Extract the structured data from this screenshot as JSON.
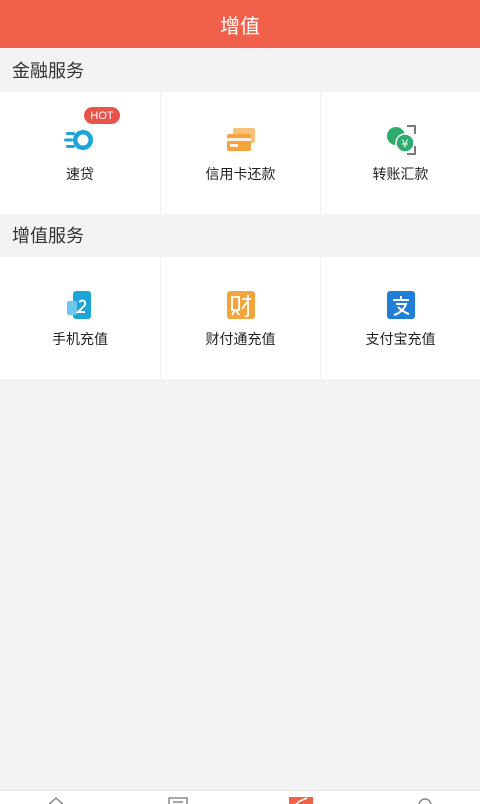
{
  "header": {
    "title": "增值"
  },
  "sections": {
    "finance": {
      "title": "金融服务",
      "items": [
        {
          "label": "速贷",
          "badge": "HOT",
          "icon": "fast-loan-icon",
          "color": "#1aa4d8"
        },
        {
          "label": "信用卡还款",
          "icon": "credit-card-icon",
          "color": "#f3a43c"
        },
        {
          "label": "转账汇款",
          "icon": "transfer-icon",
          "color": "#2dad6c"
        }
      ]
    },
    "value": {
      "title": "增值服务",
      "items": [
        {
          "label": "手机充值",
          "icon": "phone-recharge-icon",
          "color": "#1aa4d8"
        },
        {
          "label": "财付通充值",
          "icon": "tenpay-icon",
          "color": "#f3a43c"
        },
        {
          "label": "支付宝充值",
          "icon": "alipay-icon",
          "color": "#1f7fd6"
        }
      ]
    }
  },
  "bottom_nav": [
    "home-icon",
    "list-icon",
    "value-added-icon",
    "profile-icon"
  ],
  "colors": {
    "accent": "#f0604b",
    "background": "#f3f3f3"
  }
}
